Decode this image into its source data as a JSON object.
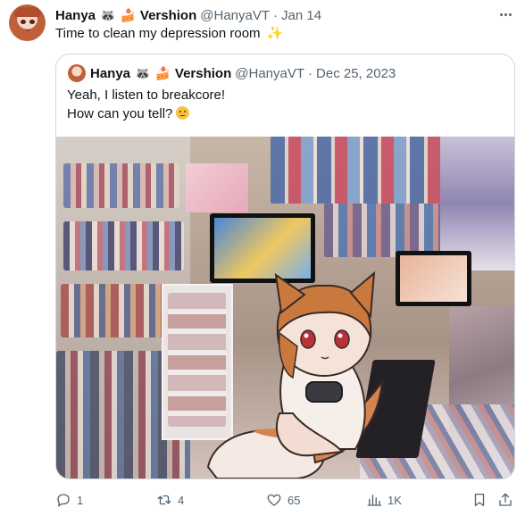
{
  "tweet": {
    "author_name": "Hanya",
    "author_name_suffix": "Vershion",
    "author_emoji_1": "🦝",
    "author_emoji_2": "🍰",
    "handle": "@HanyaVT",
    "separator": "·",
    "date": "Jan 14",
    "text": "Time to clean my depression room",
    "text_emoji": "✨"
  },
  "quoted_tweet": {
    "author_name": "Hanya",
    "author_name_suffix": "Vershion",
    "author_emoji_1": "🦝",
    "author_emoji_2": "🍰",
    "handle": "@HanyaVT",
    "separator": "·",
    "date": "Dec 25, 2023",
    "line_1": "Yeah, I listen to breakcore!",
    "line_2": "How can you tell?",
    "line_2_emoji": "thinking-face"
  },
  "actions": {
    "replies": "1",
    "reposts": "4",
    "likes": "65",
    "views": "1K"
  },
  "colors": {
    "text": "#0f1419",
    "muted": "#536471",
    "border": "#cfd9de"
  }
}
